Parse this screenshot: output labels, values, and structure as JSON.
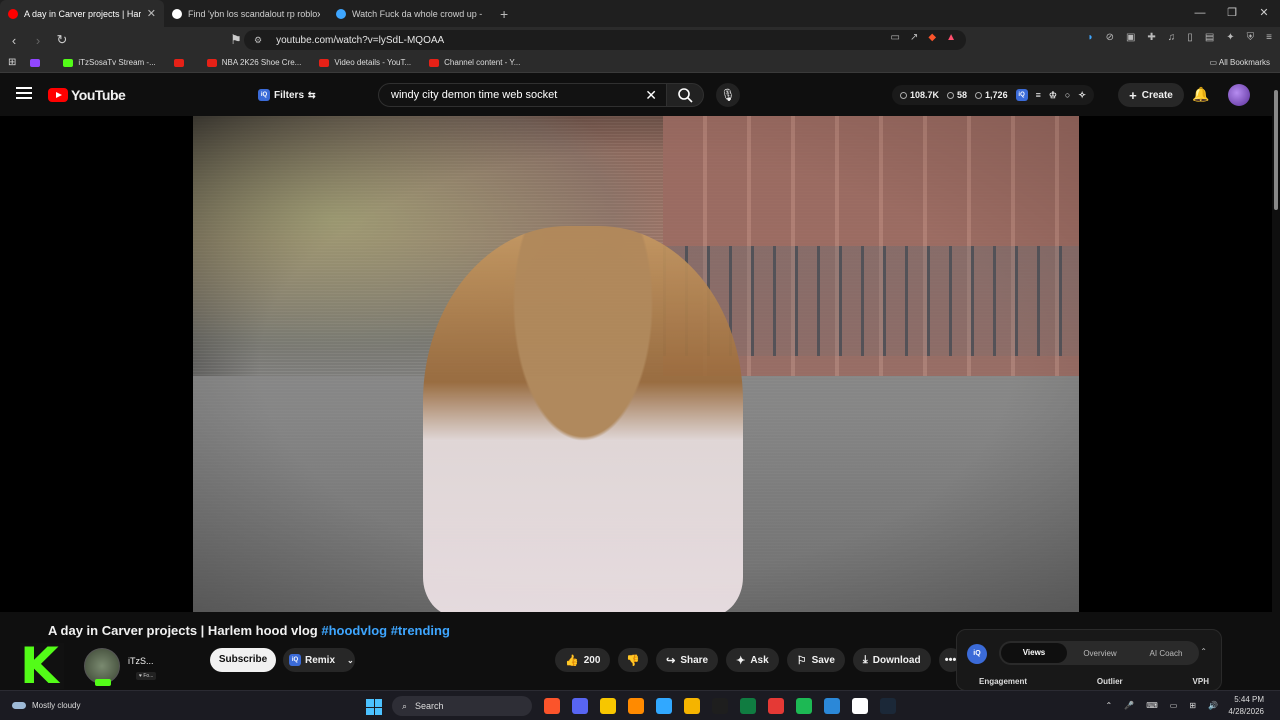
{
  "browser": {
    "tabs": [
      {
        "title": "A day in Carver projects | Harlem",
        "color": "#ff0000",
        "active": true
      },
      {
        "title": "Find 'ybn los scandalout rp roblox' o",
        "color": "#ffffff",
        "active": false
      },
      {
        "title": "Watch Fuck da whole crowd up - @T",
        "color": "#3ea6ff",
        "active": false
      }
    ],
    "new_tab": "+",
    "url": "youtube.com/watch?v=lySdL-MQOAA",
    "bookmarks": [
      {
        "label": ""
      },
      {
        "label": "iTzSosaTv Stream -..."
      },
      {
        "label": ""
      },
      {
        "label": "NBA 2K26 Shoe Cre..."
      },
      {
        "label": "Video details - YouT..."
      },
      {
        "label": "Channel content - Y..."
      }
    ],
    "all_bookmarks": "All Bookmarks"
  },
  "youtube": {
    "logo_text": "YouTube",
    "filters_label": "Filters",
    "search_value": "windy city demon time web socket",
    "stats": {
      "views": "108.7K",
      "likes": "58",
      "comments": "1,726"
    },
    "create_label": "Create",
    "video": {
      "title": "A day in Carver projects | Harlem hood vlog",
      "hashtags": [
        "#hoodvlog",
        "#trending"
      ],
      "channel_name": "iTzS...",
      "channel_sub": "Fo...",
      "subscribe_label": "Subscribe",
      "remix_label": "Remix",
      "likes": "200",
      "share_label": "Share",
      "ask_label": "Ask",
      "save_label": "Save",
      "download_label": "Download"
    },
    "iq_panel": {
      "tabs": [
        "Views",
        "Overview",
        "AI Coach"
      ],
      "active_tab": "Views",
      "columns": [
        "Engagement",
        "Outlier",
        "VPH"
      ]
    }
  },
  "taskbar": {
    "weather": "Mostly cloudy",
    "search_label": "Search",
    "time": "5:44 PM",
    "date": "4/28/2026",
    "app_colors": [
      "#fb542b",
      "#5865f2",
      "#f7c600",
      "#ff8a00",
      "#31a8ff",
      "#f5b400",
      "#1e1e1e",
      "#107c41",
      "#e53935",
      "#1db954",
      "#2b88d8",
      "#ffffff",
      "#1b2838"
    ]
  }
}
